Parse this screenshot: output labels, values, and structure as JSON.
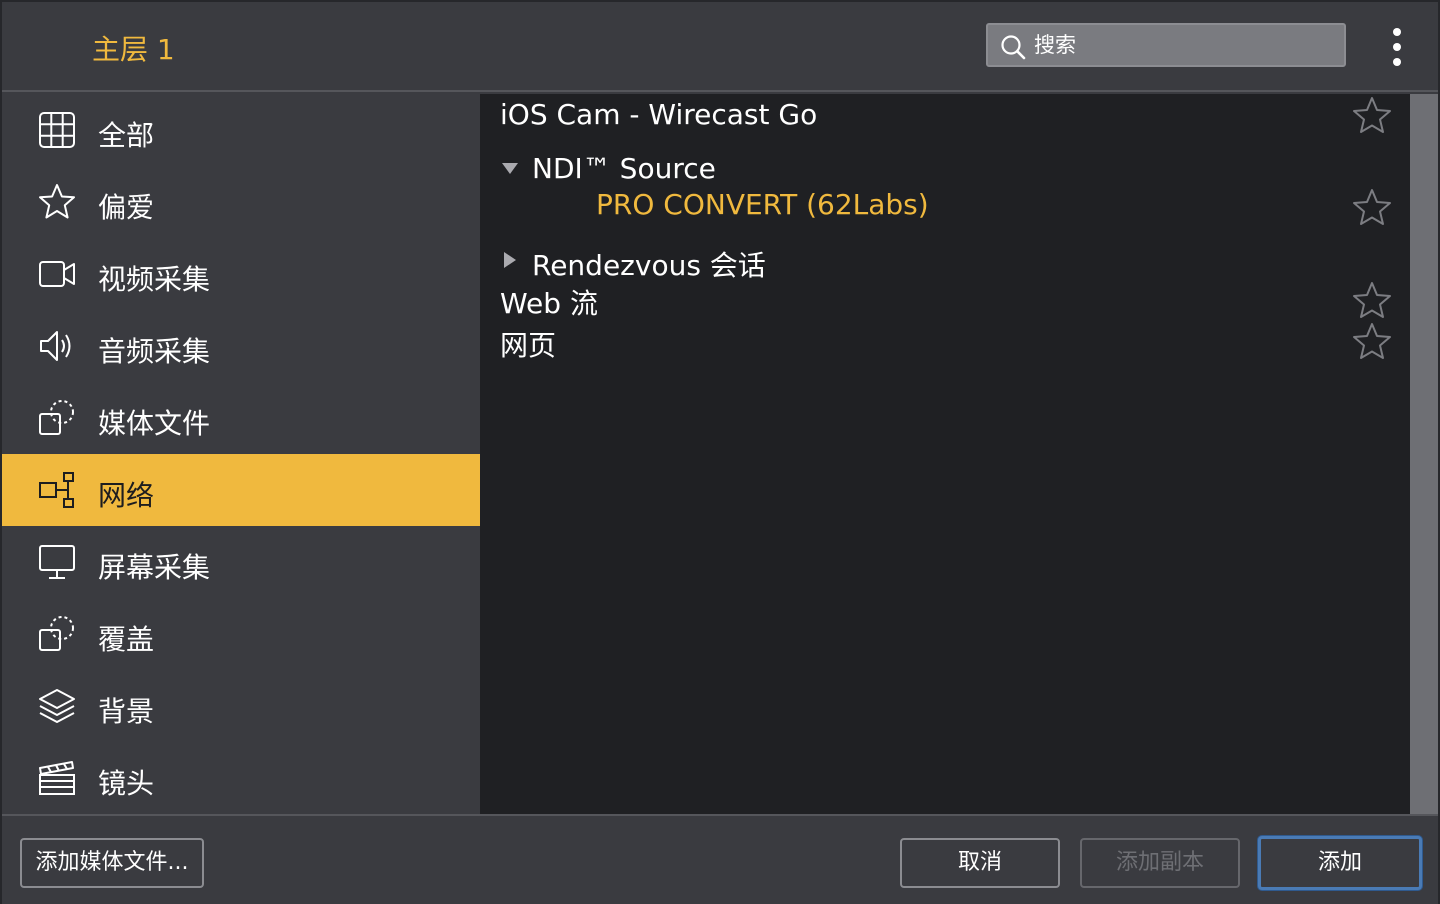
{
  "header": {
    "layer_title": "主层 1",
    "search_placeholder": "搜索",
    "menu_icon": "kebab-menu-icon"
  },
  "sidebar": {
    "items": [
      {
        "label": "全部",
        "icon": "grid-icon"
      },
      {
        "label": "偏爱",
        "icon": "star-icon"
      },
      {
        "label": "视频采集",
        "icon": "camera-icon"
      },
      {
        "label": "音频采集",
        "icon": "speaker-icon"
      },
      {
        "label": "媒体文件",
        "icon": "media-file-icon"
      },
      {
        "label": "网络",
        "icon": "network-icon",
        "selected": true
      },
      {
        "label": "屏幕采集",
        "icon": "monitor-icon"
      },
      {
        "label": "覆盖",
        "icon": "overlay-icon"
      },
      {
        "label": "背景",
        "icon": "layers-icon"
      },
      {
        "label": "镜头",
        "icon": "clapperboard-icon"
      }
    ]
  },
  "sources": {
    "ios_cam": "iOS Cam - Wirecast Go",
    "ndi_group": "NDI™ Source",
    "ndi_item": "PRO CONVERT (62Labs)",
    "rendezvous_group": "Rendezvous 会话",
    "web_stream": "Web 流",
    "web_page": "网页"
  },
  "footer": {
    "add_media": "添加媒体文件...",
    "cancel": "取消",
    "add_copy": "添加副本",
    "add": "添加"
  },
  "colors": {
    "accent": "#f0b93e",
    "panel": "#3a3b40",
    "list_bg": "#1f2023",
    "focus_ring": "#4a7bb5"
  }
}
